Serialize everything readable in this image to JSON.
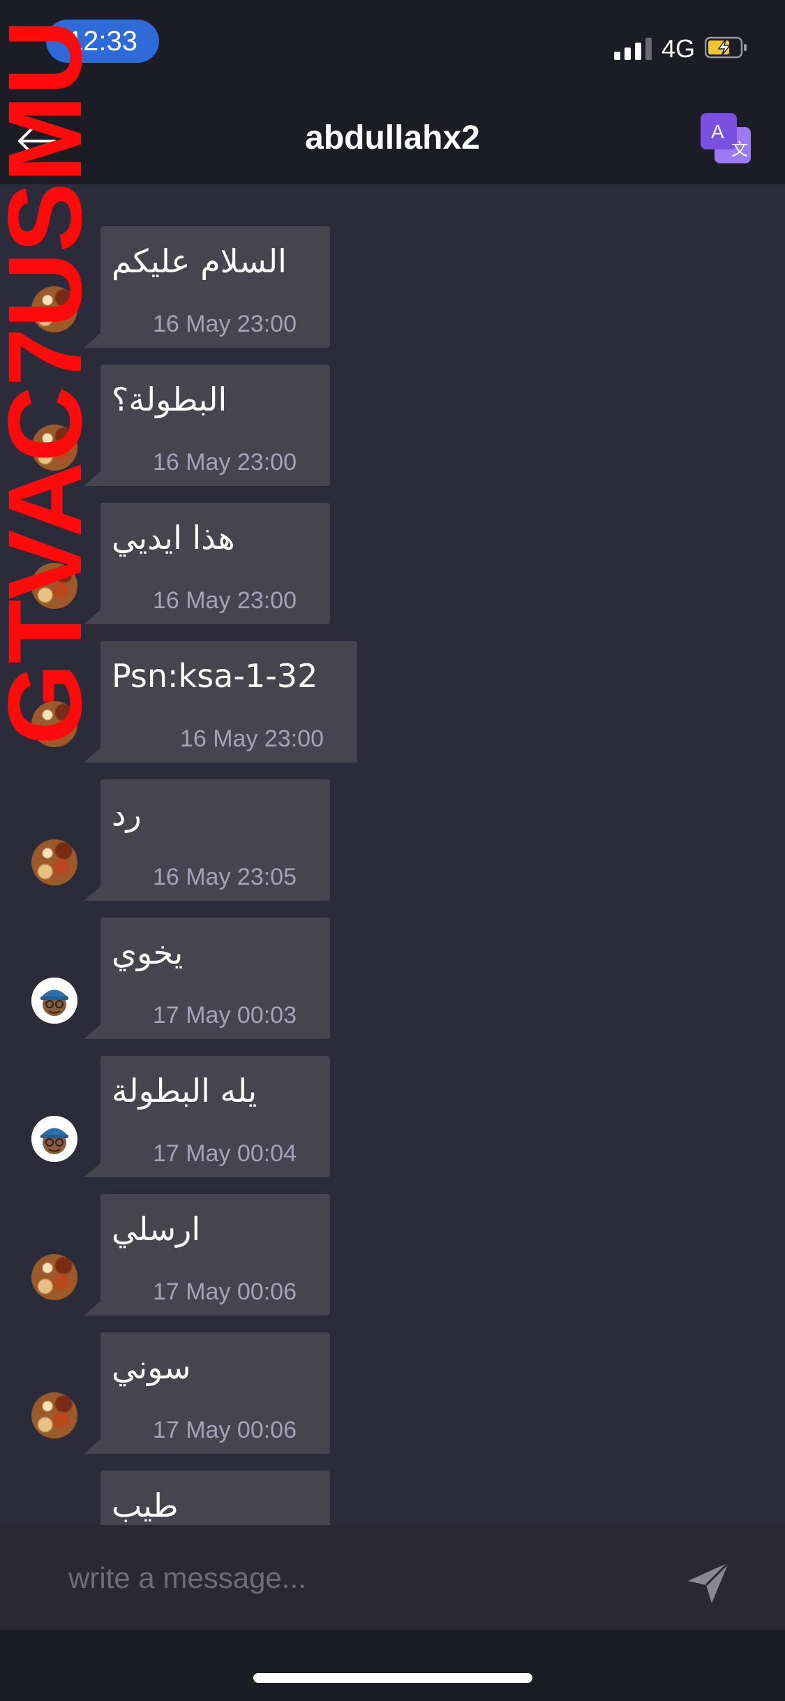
{
  "status_bar": {
    "time": "12:33",
    "network": "4G",
    "icons": [
      "signal-bars-icon",
      "battery-charging-icon"
    ]
  },
  "header": {
    "title": "abdullahx2",
    "icons": [
      "back-arrow-icon",
      "translate-icon"
    ]
  },
  "watermark": "GTVAC7USMU",
  "messages": [
    {
      "text": "السلام عليكم",
      "time": "16 May 23:00",
      "avatar": "food-avatar"
    },
    {
      "text": "البطولة؟",
      "time": "16 May 23:00",
      "avatar": "food-avatar"
    },
    {
      "text": "هذا ايديي",
      "time": "16 May 23:00",
      "avatar": "food-avatar"
    },
    {
      "text": "Psn:ksa-1-32",
      "time": "16 May 23:00",
      "avatar": "food-avatar"
    },
    {
      "text": "رد",
      "time": "16 May 23:05",
      "avatar": "food-avatar"
    },
    {
      "text": "يخوي",
      "time": "17 May 00:03",
      "avatar": "memoji-avatar"
    },
    {
      "text": "يله البطولة",
      "time": "17 May 00:04",
      "avatar": "memoji-avatar"
    },
    {
      "text": "ارسلي",
      "time": "17 May 00:06",
      "avatar": "food-avatar"
    },
    {
      "text": "سوني",
      "time": "17 May 00:06",
      "avatar": "food-avatar"
    },
    {
      "text": "طيب",
      "time": "",
      "avatar": "food-avatar"
    }
  ],
  "composer": {
    "placeholder": "write a message...",
    "value": "",
    "send_icon": "send-icon"
  },
  "colors": {
    "background": "#2c2b39",
    "bar": "#1c1c24",
    "bubble": "#46444f",
    "timestamp": "#a4a2b6",
    "time_pill": "#2f6ad9",
    "watermark": "#ff0a0a",
    "translate_accent": "#8b5cf6"
  }
}
